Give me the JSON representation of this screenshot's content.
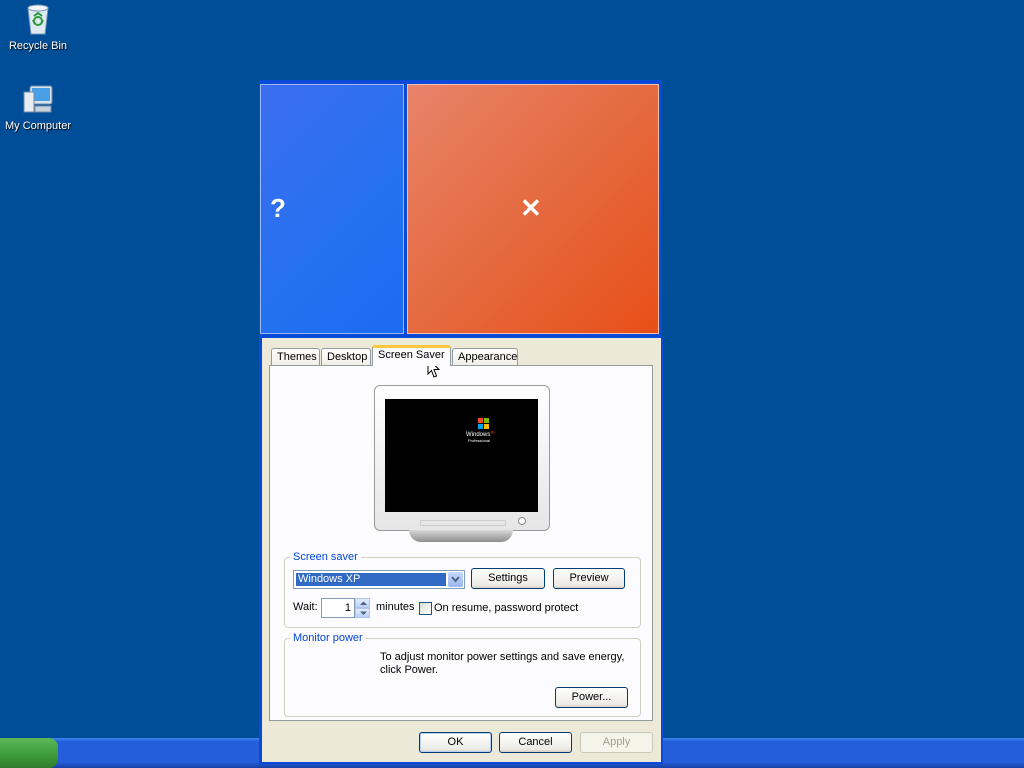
{
  "desktop": {
    "icons": [
      {
        "label": "Recycle Bin",
        "icon": "recycle-bin-icon"
      },
      {
        "label": "My Computer",
        "icon": "my-computer-icon"
      }
    ]
  },
  "tiles": {
    "help_glyph": "?",
    "close_glyph": "✕"
  },
  "dialog": {
    "tabs": [
      {
        "label": "Themes"
      },
      {
        "label": "Desktop"
      },
      {
        "label": "Screen Saver"
      },
      {
        "label": "Appearance"
      }
    ],
    "active_tab": "Screen Saver",
    "preview": {
      "logo_text": "Windows",
      "logo_sub": "Professional",
      "xp_mark": "xp"
    },
    "screen_saver": {
      "legend": "Screen saver",
      "selected": "Windows XP",
      "settings_label": "Settings",
      "preview_label": "Preview",
      "wait_label": "Wait:",
      "wait_value": "1",
      "minutes_label": "minutes",
      "password_label": "On resume, password protect",
      "password_checked": false
    },
    "monitor_power": {
      "legend": "Monitor power",
      "description": "To adjust monitor power settings and save energy, click Power.",
      "power_label": "Power..."
    },
    "buttons": {
      "ok": "OK",
      "cancel": "Cancel",
      "apply": "Apply"
    }
  },
  "colors": {
    "desktop_bg": "#004e98",
    "dialog_bg": "#ece9d8",
    "selection": "#316ac5",
    "group_legend": "#0046d5",
    "active_tab_accent": "#ffc83c"
  }
}
